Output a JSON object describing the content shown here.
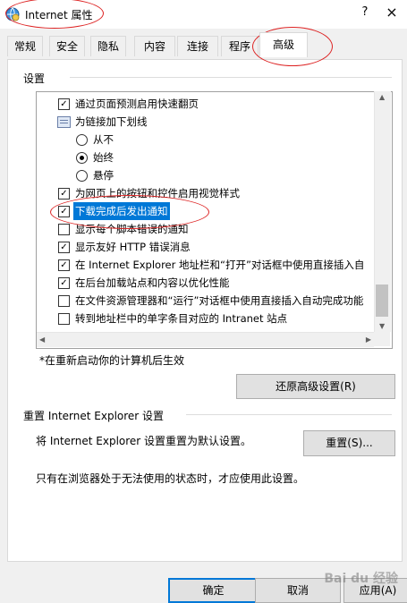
{
  "window": {
    "title": "Internet 属性",
    "help_label": "?",
    "close_label": "×"
  },
  "tabs": [
    {
      "label": "常规",
      "active": false
    },
    {
      "label": "安全",
      "active": false
    },
    {
      "label": "隐私",
      "active": false
    },
    {
      "label": "内容",
      "active": false
    },
    {
      "label": "连接",
      "active": false
    },
    {
      "label": "程序",
      "active": false
    },
    {
      "label": "高级",
      "active": true
    }
  ],
  "settings": {
    "group_label": "设置",
    "items": [
      {
        "kind": "checkbox",
        "checked": true,
        "label": "通过页面预测启用快速翻页"
      },
      {
        "kind": "group",
        "label": "为链接加下划线"
      },
      {
        "kind": "radio",
        "checked": false,
        "label": "从不"
      },
      {
        "kind": "radio",
        "checked": true,
        "label": "始终"
      },
      {
        "kind": "radio",
        "checked": false,
        "label": "悬停"
      },
      {
        "kind": "checkbox",
        "checked": true,
        "label": "为网页上的按钮和控件启用视觉样式"
      },
      {
        "kind": "checkbox",
        "checked": true,
        "label": "下载完成后发出通知",
        "selected": true
      },
      {
        "kind": "checkbox",
        "checked": false,
        "label": "显示每个脚本错误的通知"
      },
      {
        "kind": "checkbox",
        "checked": true,
        "label": "显示友好 HTTP 错误消息"
      },
      {
        "kind": "checkbox",
        "checked": true,
        "label": "在 Internet Explorer 地址栏和“打开”对话框中使用直接插入自"
      },
      {
        "kind": "checkbox",
        "checked": true,
        "label": "在后台加载站点和内容以优化性能"
      },
      {
        "kind": "checkbox",
        "checked": false,
        "label": "在文件资源管理器和“运行”对话框中使用直接插入自动完成功能"
      },
      {
        "kind": "checkbox",
        "checked": false,
        "label": "转到地址栏中的单字条目对应的 Intranet 站点"
      }
    ],
    "restart_note": "*在重新启动你的计算机后生效",
    "restore_button": "还原高级设置(R)"
  },
  "reset": {
    "group_label": "重置 Internet Explorer 设置",
    "description": "将 Internet Explorer 设置重置为默认设置。",
    "reset_button": "重置(S)...",
    "note": "只有在浏览器处于无法使用的状态时，才应使用此设置。"
  },
  "footer": {
    "ok": "确定",
    "cancel": "取消",
    "apply": "应用(A)"
  },
  "watermark": "Bai du 经验",
  "colors": {
    "selection": "#0078d7",
    "annotation": "#dd2222"
  }
}
